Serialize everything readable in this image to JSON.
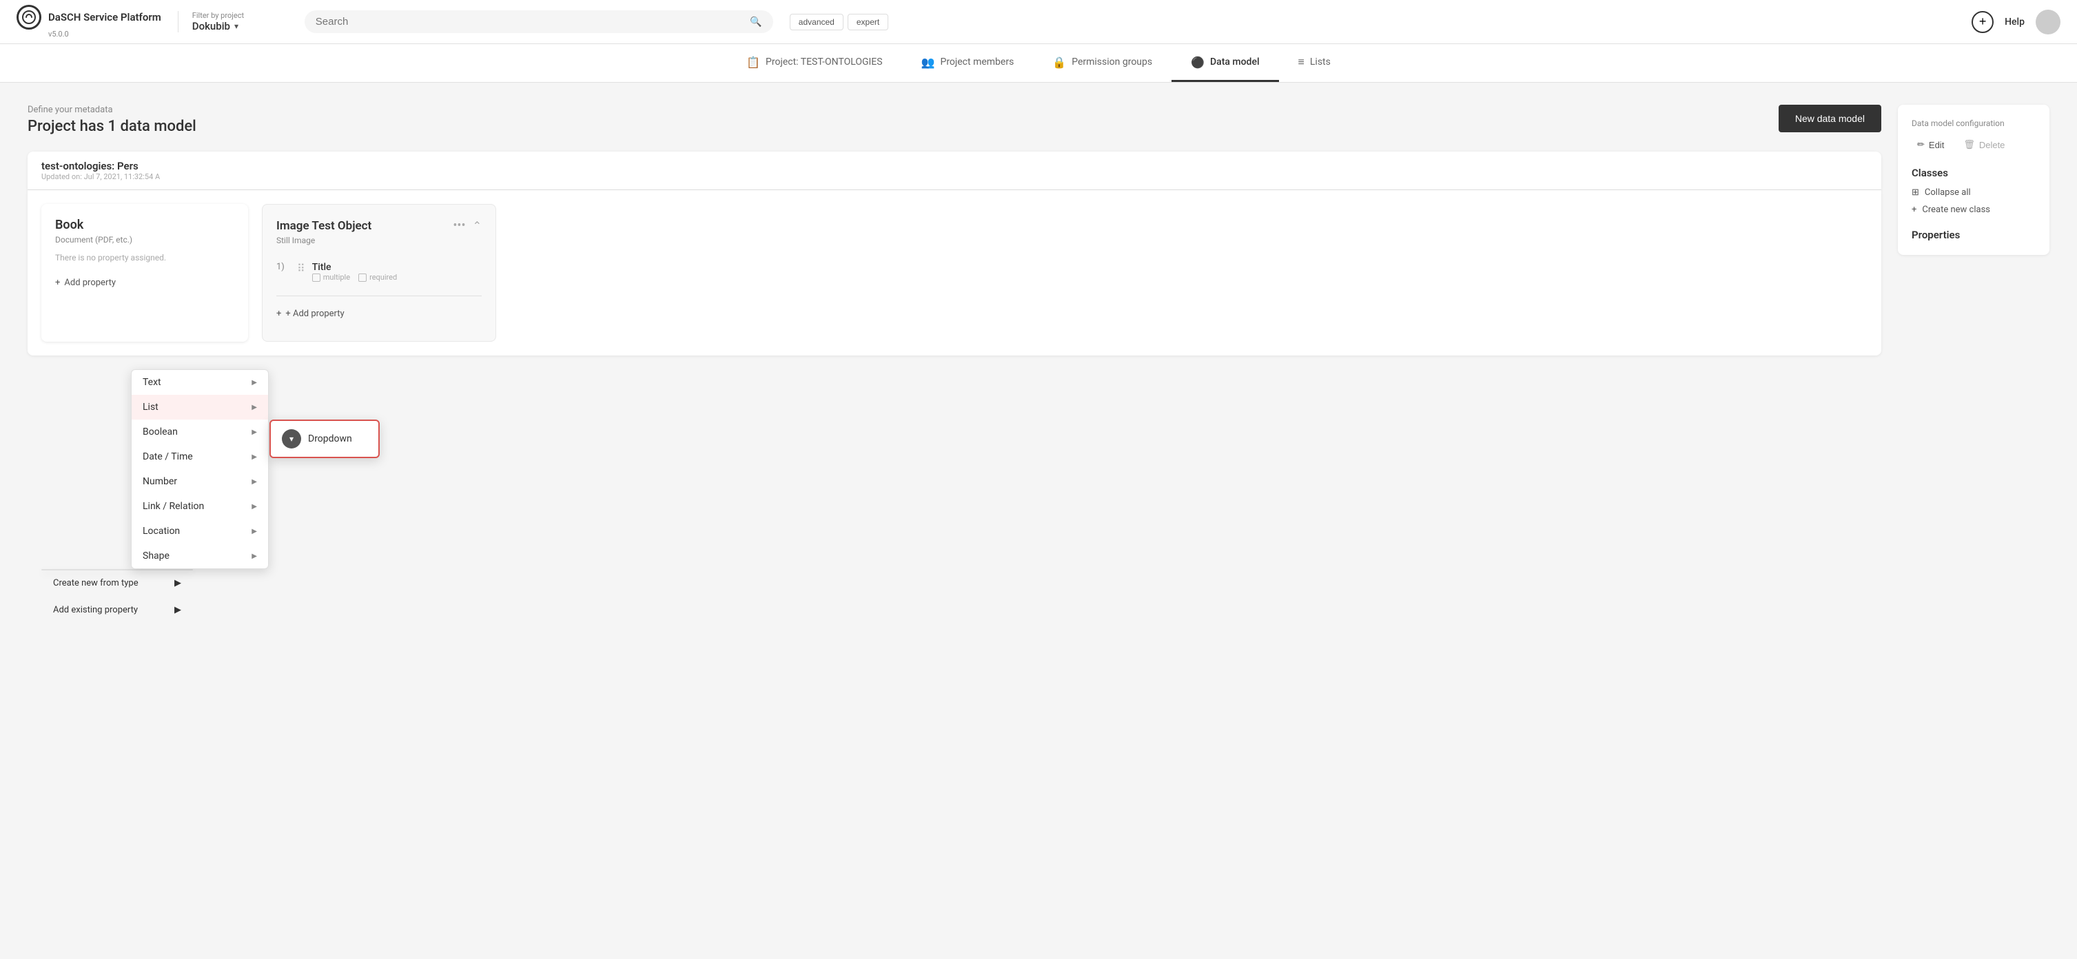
{
  "header": {
    "logo_text": "DaSCH Service Platform",
    "version": "v5.0.0",
    "filter_label": "Filter by project",
    "project_name": "Dokubib",
    "search_placeholder": "Search",
    "search_mode_advanced": "advanced",
    "search_mode_expert": "expert",
    "help_label": "Help",
    "add_icon": "+"
  },
  "nav": {
    "tabs": [
      {
        "id": "project",
        "label": "Project: TEST-ONTOLOGIES",
        "icon": "📋",
        "active": false
      },
      {
        "id": "members",
        "label": "Project members",
        "icon": "👥",
        "active": false
      },
      {
        "id": "permissions",
        "label": "Permission groups",
        "icon": "🔒",
        "active": false
      },
      {
        "id": "data-model",
        "label": "Data model",
        "icon": "⚫",
        "active": true
      },
      {
        "id": "lists",
        "label": "Lists",
        "icon": "≡",
        "active": false
      }
    ]
  },
  "main": {
    "define_label": "Define your metadata",
    "page_title": "Project has 1 data model",
    "new_data_model_btn": "New data model",
    "ontology_name": "test-ontologies: Pers",
    "ontology_updated": "Updated on: Jul 7, 2021, 11:32:54 A",
    "book_card": {
      "title": "Book",
      "subtitle": "Document (PDF, etc.)",
      "no_property_text": "There is no property assigned.",
      "add_property_label": "+ Add property"
    },
    "image_card": {
      "title": "Image Test Object",
      "subtitle": "Still Image",
      "properties": [
        {
          "num": "1)",
          "name": "Title",
          "multiple_label": "multiple",
          "required_label": "required"
        }
      ],
      "add_property_label": "+ Add property"
    }
  },
  "context_menu": {
    "items": [
      {
        "id": "text",
        "label": "Text"
      },
      {
        "id": "list",
        "label": "List",
        "highlighted": true
      },
      {
        "id": "boolean",
        "label": "Boolean"
      },
      {
        "id": "datetime",
        "label": "Date / Time"
      },
      {
        "id": "number",
        "label": "Number"
      },
      {
        "id": "link-relation",
        "label": "Link / Relation"
      },
      {
        "id": "location",
        "label": "Location"
      },
      {
        "id": "shape",
        "label": "Shape"
      }
    ]
  },
  "submenu": {
    "items": [
      {
        "id": "dropdown",
        "label": "Dropdown"
      }
    ]
  },
  "create_options": {
    "items": [
      {
        "id": "create-new-from-type",
        "label": "Create new from type"
      },
      {
        "id": "add-existing-property",
        "label": "Add existing property"
      }
    ]
  },
  "right_sidebar": {
    "config_label": "Data model configuration",
    "edit_label": "Edit",
    "delete_label": "Delete",
    "classes_title": "Classes",
    "collapse_all_label": "Collapse all",
    "create_new_class_label": "Create new class",
    "properties_title": "Properties"
  }
}
